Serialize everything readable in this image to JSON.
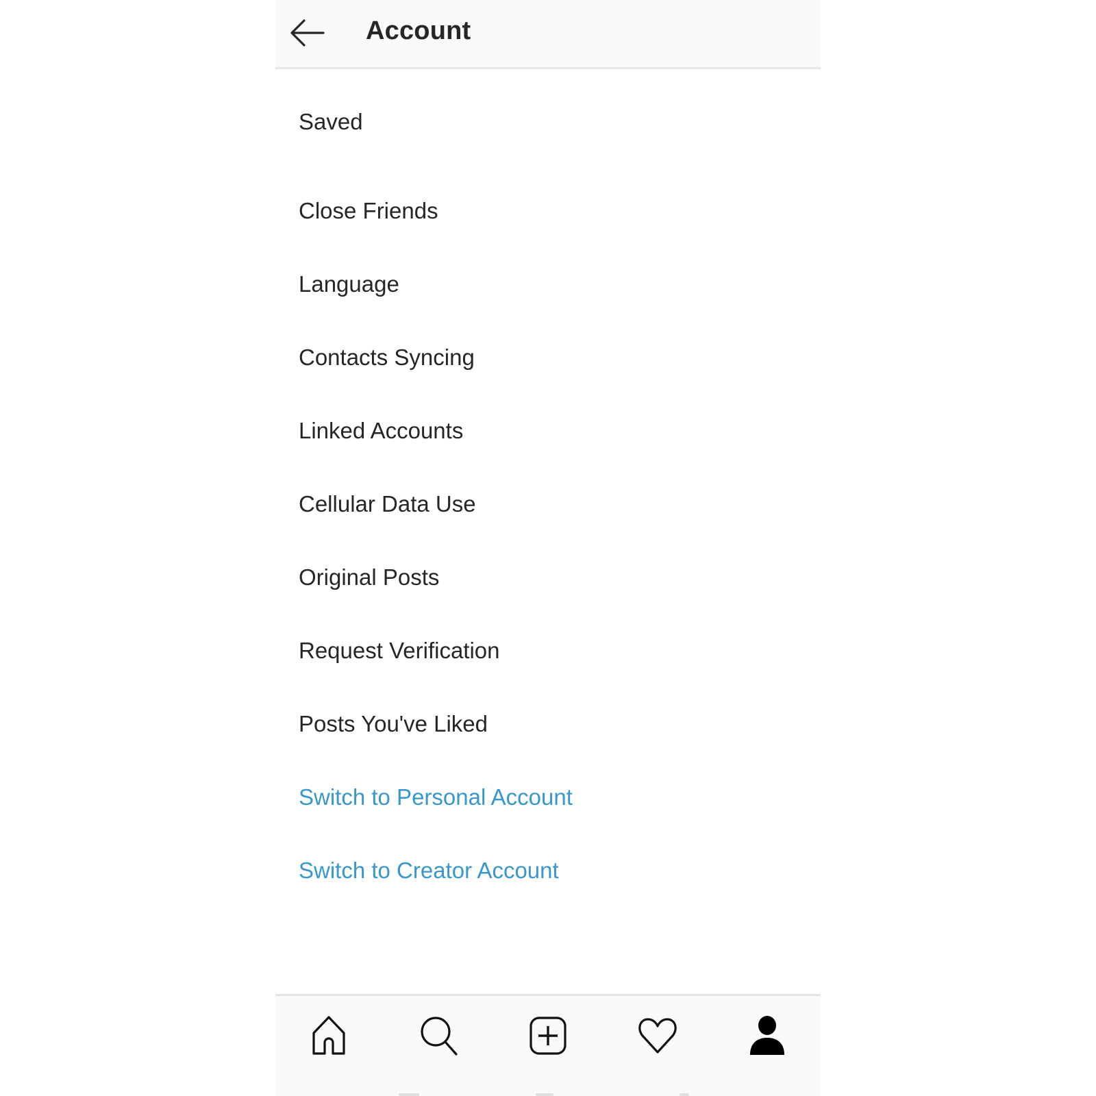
{
  "header": {
    "back_icon": "arrow-left-icon",
    "title": "Account"
  },
  "menu": {
    "items": [
      {
        "label": "Saved"
      },
      {
        "label": "Close Friends"
      },
      {
        "label": "Language"
      },
      {
        "label": "Contacts Syncing"
      },
      {
        "label": "Linked Accounts"
      },
      {
        "label": "Cellular Data Use"
      },
      {
        "label": "Original Posts"
      },
      {
        "label": "Request Verification"
      },
      {
        "label": "Posts You've Liked"
      }
    ],
    "links": [
      {
        "label": "Switch to Personal Account"
      },
      {
        "label": "Switch to Creator Account"
      }
    ]
  },
  "bottom_nav": {
    "items": [
      {
        "icon": "home-icon"
      },
      {
        "icon": "search-icon"
      },
      {
        "icon": "add-post-icon"
      },
      {
        "icon": "heart-icon"
      },
      {
        "icon": "profile-icon",
        "active": true
      }
    ]
  },
  "colors": {
    "text": "#262626",
    "link": "#3897cc",
    "bar_background": "#fafafa"
  }
}
